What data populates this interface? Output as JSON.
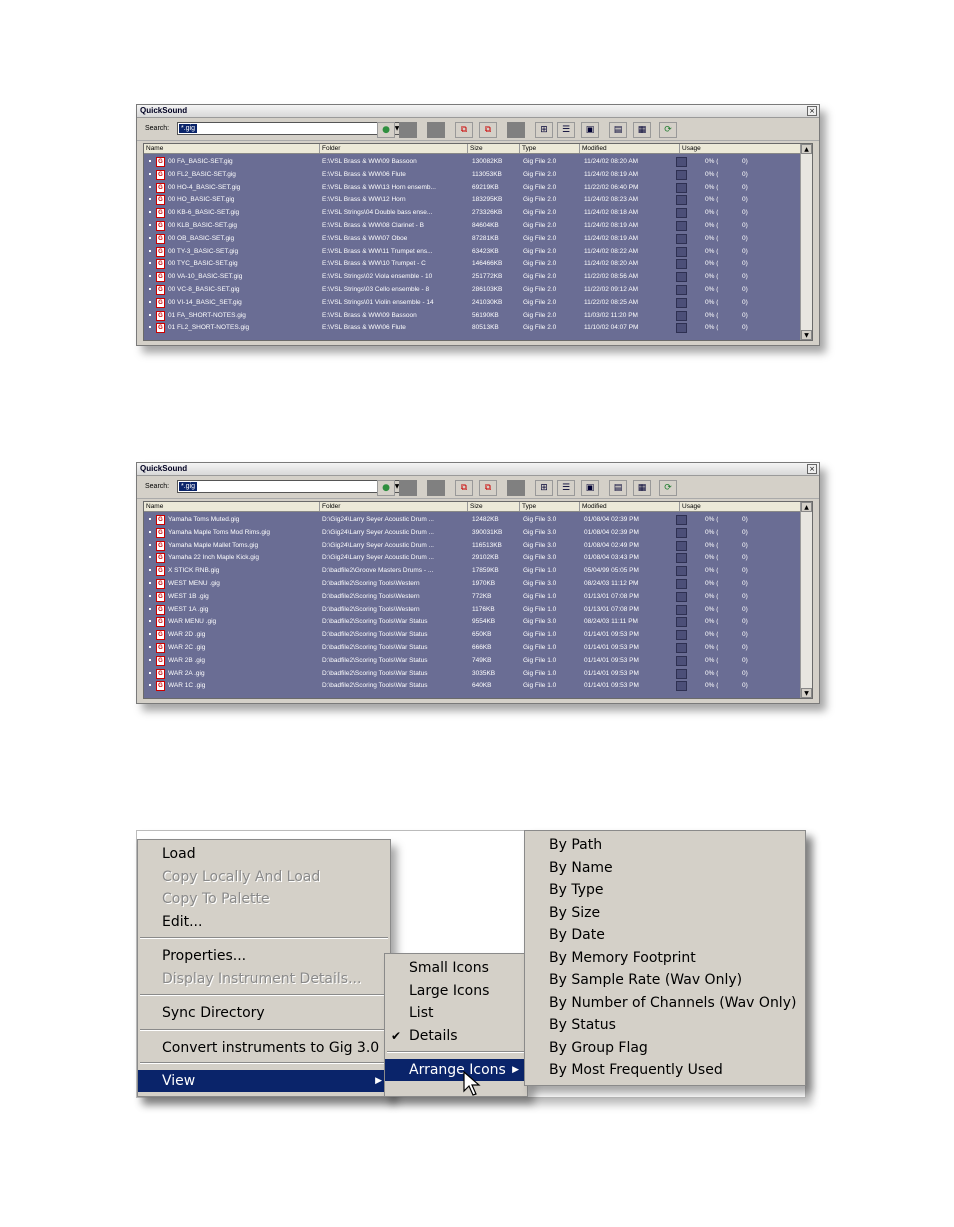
{
  "window_title": "QuickSound",
  "close_glyph": "×",
  "search_label": "Search:",
  "search_value_1": "*.gig",
  "search_value_2": "*.gig",
  "dropdown_glyph": "▼",
  "columns": {
    "name": "Name",
    "folder": "Folder",
    "size": "Size",
    "type": "Type",
    "modified": "Modified",
    "usage": "Usage"
  },
  "icon_letter": "G",
  "list1": [
    {
      "name": "00 FA_BASIC-SET.gig",
      "folder": "E:\\VSL Brass & WW\\09 Bassoon",
      "size": "130082KB",
      "type": "Gig File 2.0",
      "modified": "11/24/02 08:20 AM",
      "usage": "0% (",
      "count": "0)"
    },
    {
      "name": "00 FL2_BASIC-SET.gig",
      "folder": "E:\\VSL Brass & WW\\06 Flute",
      "size": "113053KB",
      "type": "Gig File 2.0",
      "modified": "11/24/02 08:19 AM",
      "usage": "0% (",
      "count": "0)"
    },
    {
      "name": "00 HO-4_BASIC-SET.gig",
      "folder": "E:\\VSL Brass & WW\\13 Horn ensemb...",
      "size": "69219KB",
      "type": "Gig File 2.0",
      "modified": "11/22/02 06:40 PM",
      "usage": "0% (",
      "count": "0)"
    },
    {
      "name": "00 HO_BASIC-SET.gig",
      "folder": "E:\\VSL Brass & WW\\12 Horn",
      "size": "183295KB",
      "type": "Gig File 2.0",
      "modified": "11/24/02 08:23 AM",
      "usage": "0% (",
      "count": "0)"
    },
    {
      "name": "00 KB-6_BASIC-SET.gig",
      "folder": "E:\\VSL Strings\\04 Double bass ense...",
      "size": "273326KB",
      "type": "Gig File 2.0",
      "modified": "11/24/02 08:18 AM",
      "usage": "0% (",
      "count": "0)"
    },
    {
      "name": "00 KLB_BASIC-SET.gig",
      "folder": "E:\\VSL Brass & WW\\08 Clarinet - B",
      "size": "84604KB",
      "type": "Gig File 2.0",
      "modified": "11/24/02 08:19 AM",
      "usage": "0% (",
      "count": "0)"
    },
    {
      "name": "00 OB_BASIC-SET.gig",
      "folder": "E:\\VSL Brass & WW\\07 Oboe",
      "size": "87281KB",
      "type": "Gig File 2.0",
      "modified": "11/24/02 08:19 AM",
      "usage": "0% (",
      "count": "0)"
    },
    {
      "name": "00 TY-3_BASIC-SET.gig",
      "folder": "E:\\VSL Brass & WW\\11 Trumpet ens...",
      "size": "63423KB",
      "type": "Gig File 2.0",
      "modified": "11/24/02 08:22 AM",
      "usage": "0% (",
      "count": "0)"
    },
    {
      "name": "00 TYC_BASIC-SET.gig",
      "folder": "E:\\VSL Brass & WW\\10 Trumpet - C",
      "size": "146466KB",
      "type": "Gig File 2.0",
      "modified": "11/24/02 08:20 AM",
      "usage": "0% (",
      "count": "0)"
    },
    {
      "name": "00 VA-10_BASIC-SET.gig",
      "folder": "E:\\VSL Strings\\02 Viola ensemble - 10",
      "size": "251772KB",
      "type": "Gig File 2.0",
      "modified": "11/22/02 08:56 AM",
      "usage": "0% (",
      "count": "0)"
    },
    {
      "name": "00 VC-8_BASIC-SET.gig",
      "folder": "E:\\VSL Strings\\03 Cello ensemble - 8",
      "size": "286103KB",
      "type": "Gig File 2.0",
      "modified": "11/22/02 09:12 AM",
      "usage": "0% (",
      "count": "0)"
    },
    {
      "name": "00 VI-14_BASIC_SET.gig",
      "folder": "E:\\VSL Strings\\01 Violin ensemble - 14",
      "size": "241030KB",
      "type": "Gig File 2.0",
      "modified": "11/22/02 08:25 AM",
      "usage": "0% (",
      "count": "0)"
    },
    {
      "name": "01 FA_SHORT-NOTES.gig",
      "folder": "E:\\VSL Brass & WW\\09 Bassoon",
      "size": "56190KB",
      "type": "Gig File 2.0",
      "modified": "11/03/02 11:20 PM",
      "usage": "0% (",
      "count": "0)"
    },
    {
      "name": "01 FL2_SHORT-NOTES.gig",
      "folder": "E:\\VSL Brass & WW\\06 Flute",
      "size": "80513KB",
      "type": "Gig File 2.0",
      "modified": "11/10/02 04:07 PM",
      "usage": "0% (",
      "count": "0)"
    }
  ],
  "list2": [
    {
      "name": "Yamaha Toms Muted.gig",
      "folder": "D:\\Gig24\\Larry Seyer Acoustic Drum ...",
      "size": "12482KB",
      "type": "Gig File 3.0",
      "modified": "01/08/04 02:39 PM",
      "usage": "0% (",
      "count": "0)"
    },
    {
      "name": "Yamaha Maple Toms Mod Rims.gig",
      "folder": "D:\\Gig24\\Larry Seyer Acoustic Drum ...",
      "size": "390031KB",
      "type": "Gig File 3.0",
      "modified": "01/08/04 02:39 PM",
      "usage": "0% (",
      "count": "0)"
    },
    {
      "name": "Yamaha Maple Mallet Toms.gig",
      "folder": "D:\\Gig24\\Larry Seyer Acoustic Drum ...",
      "size": "116513KB",
      "type": "Gig File 3.0",
      "modified": "01/08/04 02:49 PM",
      "usage": "0% (",
      "count": "0)"
    },
    {
      "name": "Yamaha 22 Inch Maple Kick.gig",
      "folder": "D:\\Gig24\\Larry Seyer Acoustic Drum ...",
      "size": "29102KB",
      "type": "Gig File 3.0",
      "modified": "01/08/04 03:43 PM",
      "usage": "0% (",
      "count": "0)"
    },
    {
      "name": "X STICK RNB.gig",
      "folder": "D:\\badfile2\\Groove Masters Drums - ...",
      "size": "17859KB",
      "type": "Gig File 1.0",
      "modified": "05/04/99 05:05 PM",
      "usage": "0% (",
      "count": "0)"
    },
    {
      "name": "WEST MENU    .gig",
      "folder": "D:\\badfile2\\Scoring Tools\\Western",
      "size": "1970KB",
      "type": "Gig File 3.0",
      "modified": "08/24/03 11:12 PM",
      "usage": "0% (",
      "count": "0)"
    },
    {
      "name": "WEST 1B      .gig",
      "folder": "D:\\badfile2\\Scoring Tools\\Western",
      "size": "772KB",
      "type": "Gig File 1.0",
      "modified": "01/13/01 07:08 PM",
      "usage": "0% (",
      "count": "0)"
    },
    {
      "name": "WEST 1A      .gig",
      "folder": "D:\\badfile2\\Scoring Tools\\Western",
      "size": "1176KB",
      "type": "Gig File 1.0",
      "modified": "01/13/01 07:08 PM",
      "usage": "0% (",
      "count": "0)"
    },
    {
      "name": "WAR MENU     .gig",
      "folder": "D:\\badfile2\\Scoring Tools\\War Status",
      "size": "9554KB",
      "type": "Gig File 3.0",
      "modified": "08/24/03 11:11 PM",
      "usage": "0% (",
      "count": "0)"
    },
    {
      "name": "WAR 2D       .gig",
      "folder": "D:\\badfile2\\Scoring Tools\\War Status",
      "size": "650KB",
      "type": "Gig File 1.0",
      "modified": "01/14/01 09:53 PM",
      "usage": "0% (",
      "count": "0)"
    },
    {
      "name": "WAR 2C       .gig",
      "folder": "D:\\badfile2\\Scoring Tools\\War Status",
      "size": "666KB",
      "type": "Gig File 1.0",
      "modified": "01/14/01 09:53 PM",
      "usage": "0% (",
      "count": "0)"
    },
    {
      "name": "WAR 2B       .gig",
      "folder": "D:\\badfile2\\Scoring Tools\\War Status",
      "size": "749KB",
      "type": "Gig File 1.0",
      "modified": "01/14/01 09:53 PM",
      "usage": "0% (",
      "count": "0)"
    },
    {
      "name": "WAR 2A       .gig",
      "folder": "D:\\badfile2\\Scoring Tools\\War Status",
      "size": "3035KB",
      "type": "Gig File 1.0",
      "modified": "01/14/01 09:53 PM",
      "usage": "0% (",
      "count": "0)"
    },
    {
      "name": "WAR 1C       .gig",
      "folder": "D:\\badfile2\\Scoring Tools\\War Status",
      "size": "640KB",
      "type": "Gig File 1.0",
      "modified": "01/14/01 09:53 PM",
      "usage": "0% (",
      "count": "0)"
    }
  ],
  "context_menu": [
    {
      "label": "Load",
      "disabled": false
    },
    {
      "label": "Copy Locally And Load",
      "disabled": true
    },
    {
      "label": "Copy To Palette",
      "disabled": true
    },
    {
      "label": "Edit...",
      "disabled": false
    },
    {
      "label": "Properties...",
      "disabled": false
    },
    {
      "label": "Display Instrument Details...",
      "disabled": true
    },
    {
      "label": "Sync Directory",
      "disabled": false
    },
    {
      "label": "Convert instruments to Gig 3.0",
      "disabled": false
    },
    {
      "label": "View",
      "selected": true
    }
  ],
  "view_menu": [
    {
      "label": "Small Icons"
    },
    {
      "label": "Large Icons"
    },
    {
      "label": "List"
    },
    {
      "label": "Details",
      "checked": true
    },
    {
      "label": "Arrange Icons",
      "selected": true
    }
  ],
  "arrange_menu": [
    "By Path",
    "By Name",
    "By Type",
    "By Size",
    "By Date",
    "By Memory Footprint",
    "By Sample Rate (Wav Only)",
    "By Number of Channels (Wav Only)",
    "By Status",
    "By Group Flag",
    "By Most Frequently Used"
  ],
  "glyphs": {
    "submenu_arrow": "▶",
    "check": "✔",
    "scroll_up": "▲",
    "scroll_down": "▼"
  },
  "colors": {
    "list_bg": "#6a6d94",
    "selection": "#0a246a",
    "menu_bg": "#d4d0c8"
  }
}
